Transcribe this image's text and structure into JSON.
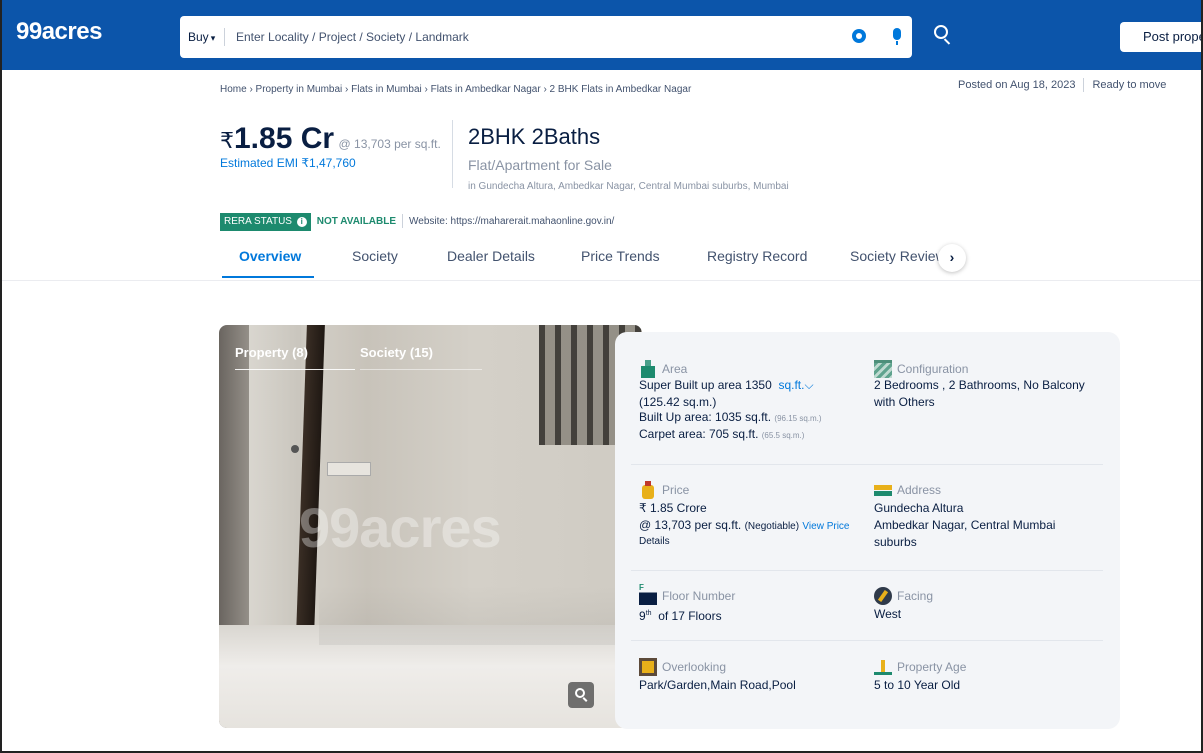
{
  "header": {
    "logo": "99acres",
    "search": {
      "buy_label": "Buy",
      "placeholder": "Enter Locality / Project / Society / Landmark"
    },
    "post_button": "Post proper"
  },
  "breadcrumb": "Home › Property in Mumbai › Flats in Mumbai › Flats in Ambedkar Nagar › 2 BHK Flats in Ambedkar Nagar",
  "posted": {
    "date": "Posted on Aug 18, 2023",
    "status": "Ready to move"
  },
  "listing": {
    "price_symbol": "₹",
    "price": "1.85 Cr",
    "per_sqft": "@ 13,703 per sq.ft.",
    "emi": "Estimated EMI ₹1,47,760",
    "bhk": "2BHK 2Baths",
    "type": "Flat/Apartment for Sale",
    "location": "in Gundecha Altura, Ambedkar Nagar, Central Mumbai suburbs, Mumbai"
  },
  "rera": {
    "label": "RERA STATUS",
    "status": "NOT AVAILABLE",
    "website": "Website: https://maharerait.mahaonline.gov.in/"
  },
  "tabs": [
    {
      "label": "Overview",
      "active": true
    },
    {
      "label": "Society",
      "active": false
    },
    {
      "label": "Dealer Details",
      "active": false
    },
    {
      "label": "Price Trends",
      "active": false
    },
    {
      "label": "Registry Record",
      "active": false
    },
    {
      "label": "Society Reviews",
      "active": false
    }
  ],
  "tab_next": "›",
  "gallery": {
    "tab_property": "Property (8)",
    "tab_society": "Society (15)",
    "watermark": "99acres"
  },
  "details": {
    "area": {
      "label": "Area",
      "super_prefix": "Super Built up area 1350",
      "unit": "sq.ft.",
      "unit_caret": "⌵",
      "super_sqm": "(125.42 sq.m.)",
      "built_up": "Built Up area: 1035 sq.ft.",
      "built_up_sqm": "(96.15 sq.m.)",
      "carpet": "Carpet area: 705 sq.ft.",
      "carpet_sqm": "(65.5 sq.m.)"
    },
    "configuration": {
      "label": "Configuration",
      "line1": "2 Bedrooms , 2 Bathrooms, No Balcony",
      "line2": "with Others"
    },
    "price": {
      "label": "Price",
      "value": "₹ 1.85 Crore",
      "per_sqft": "@ 13,703 per sq.ft.",
      "negotiable": "(Negotiable)",
      "link1": "View Price",
      "link2": "Details"
    },
    "address": {
      "label": "Address",
      "line1": "Gundecha Altura",
      "line2": "Ambedkar Nagar, Central Mumbai",
      "line3": "suburbs"
    },
    "floor": {
      "label": "Floor Number",
      "floor": "9",
      "suffix": "th",
      "of": "of 17 Floors"
    },
    "facing": {
      "label": "Facing",
      "value": "West"
    },
    "overlooking": {
      "label": "Overlooking",
      "value": "Park/Garden,Main Road,Pool"
    },
    "age": {
      "label": "Property Age",
      "value": "5 to 10 Year Old"
    }
  },
  "colors": {
    "header_blue": "#0c55aa",
    "accent_blue": "#0078db",
    "rera_green": "#1d8a6e"
  }
}
